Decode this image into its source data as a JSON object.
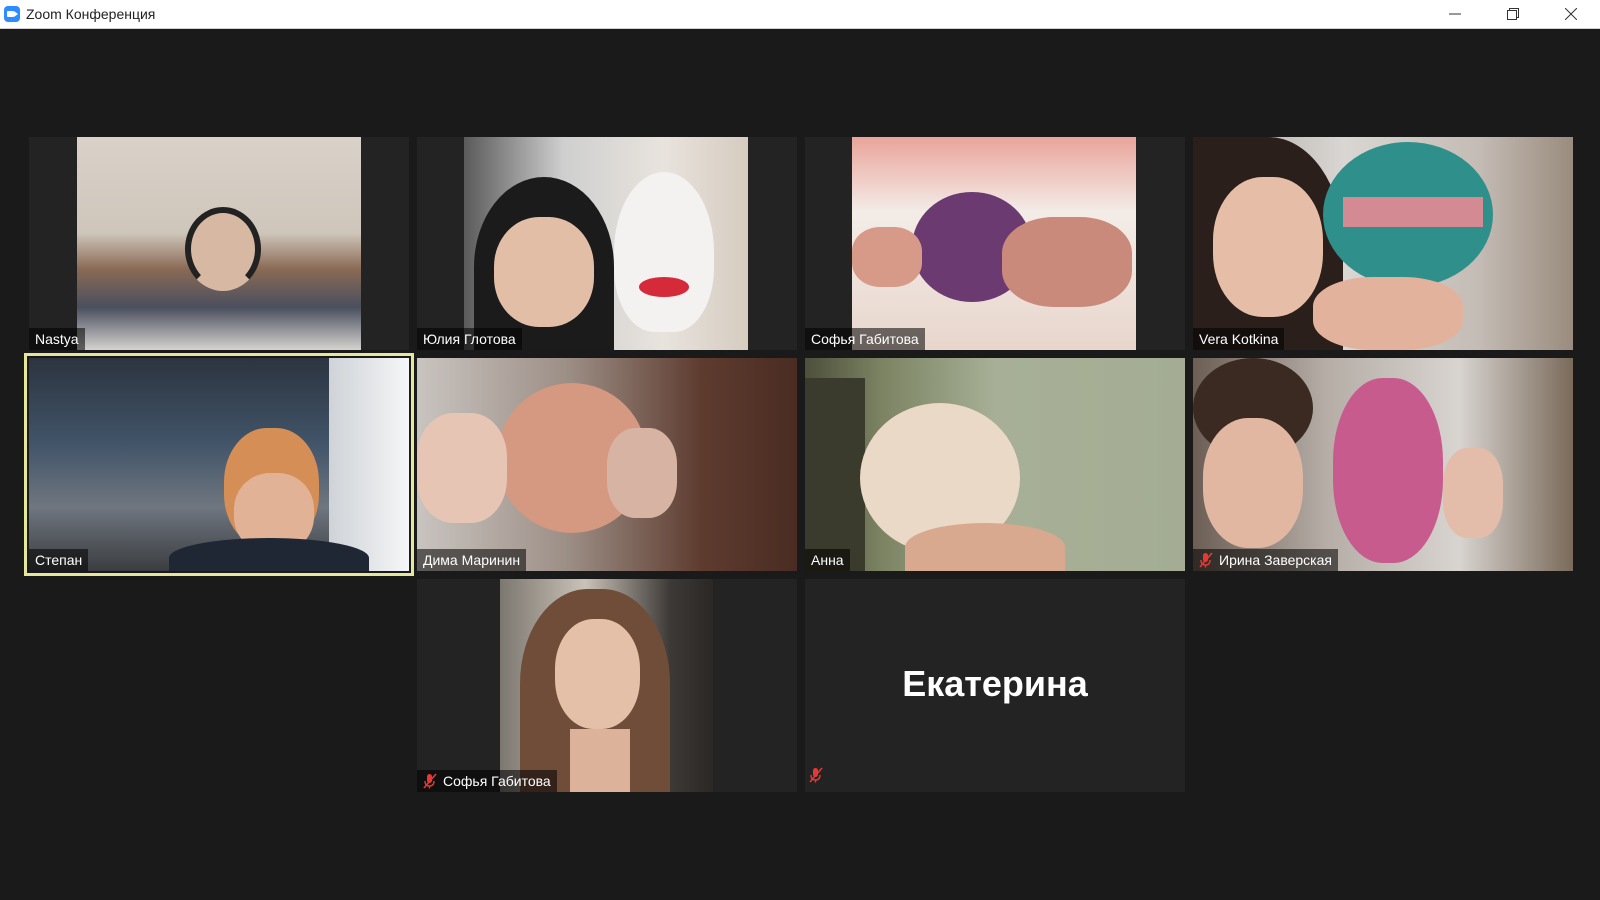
{
  "window": {
    "title": "Zoom Конференция"
  },
  "controls": {
    "minimize": "minimize-icon",
    "maximize": "restore-icon",
    "close": "close-icon"
  },
  "participants": [
    {
      "name": "Nastya",
      "muted": false
    },
    {
      "name": "Юлия Глотова",
      "muted": false
    },
    {
      "name": "Софья Габитова",
      "muted": false
    },
    {
      "name": "Vera Kotkina",
      "muted": false
    },
    {
      "name": "Степан",
      "muted": false,
      "active_speaker": true
    },
    {
      "name": "Дима Маринин",
      "muted": false
    },
    {
      "name": "Анна",
      "muted": false
    },
    {
      "name": "Ирина Заверская",
      "muted": true
    },
    {
      "name": "Софья Габитова",
      "muted": true
    },
    {
      "name": "Екатерина",
      "muted": true,
      "video_off": true
    }
  ],
  "colors": {
    "active_speaker": "#e5e89a",
    "mute": "#e53935",
    "zoom_blue": "#2d8cff"
  }
}
